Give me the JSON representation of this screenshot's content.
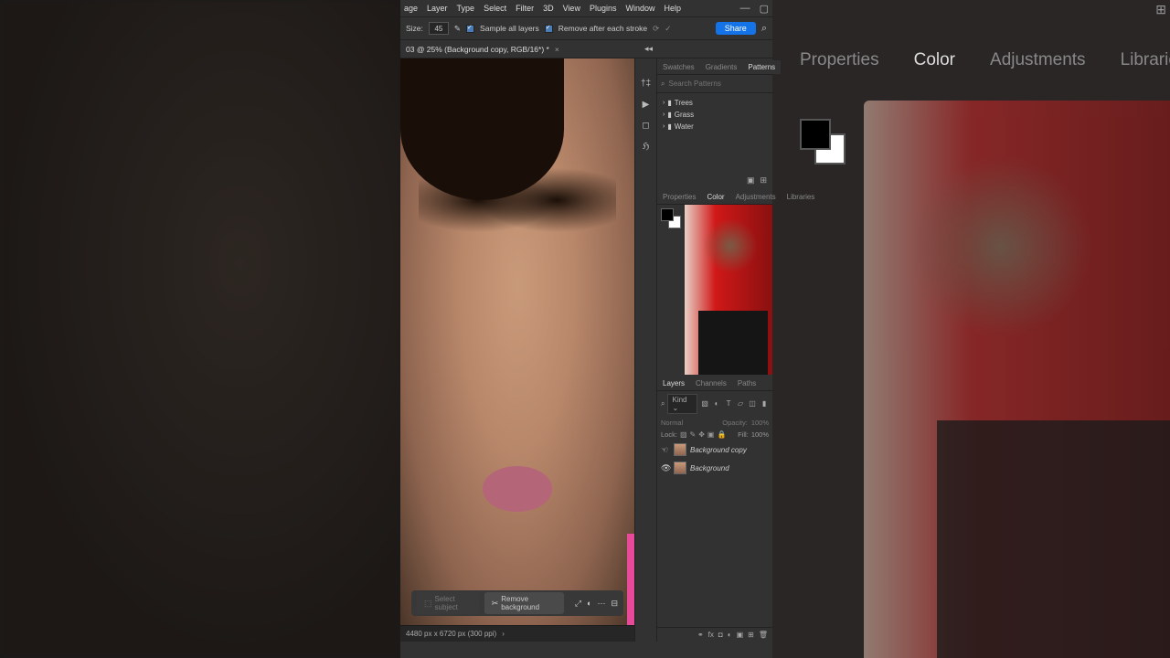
{
  "menubar": [
    "age",
    "Layer",
    "Type",
    "Select",
    "Filter",
    "3D",
    "View",
    "Plugins",
    "Window",
    "Help"
  ],
  "options": {
    "size_label": "Size:",
    "size_value": "45",
    "sample_all": "Sample all layers",
    "remove_stroke": "Remove after each stroke",
    "share": "Share"
  },
  "doc_tab": "03 @ 25% (Background copy, RGB/16*) *",
  "ctx": {
    "select_subject": "Select subject",
    "remove_bg": "Remove background"
  },
  "status": {
    "dims": "4480 px x 6720 px (300 ppi)"
  },
  "patterns": {
    "tabs": [
      "Swatches",
      "Gradients",
      "Patterns"
    ],
    "search_placeholder": "Search Patterns",
    "folders": [
      "Trees",
      "Grass",
      "Water"
    ]
  },
  "color_panel": {
    "tabs": [
      "Properties",
      "Color",
      "Adjustments",
      "Libraries"
    ]
  },
  "layers": {
    "tabs": [
      "Layers",
      "Channels",
      "Paths"
    ],
    "filter_kind": "Kind",
    "blend": "Normal",
    "opacity_label": "Opacity:",
    "opacity_value": "100%",
    "lock_label": "Lock:",
    "fill_label": "Fill:",
    "fill_value": "100%",
    "items": [
      {
        "name": "Background copy"
      },
      {
        "name": "Background"
      }
    ]
  },
  "zoom_tabs": [
    "Properties",
    "Color",
    "Adjustments",
    "Libraries"
  ]
}
